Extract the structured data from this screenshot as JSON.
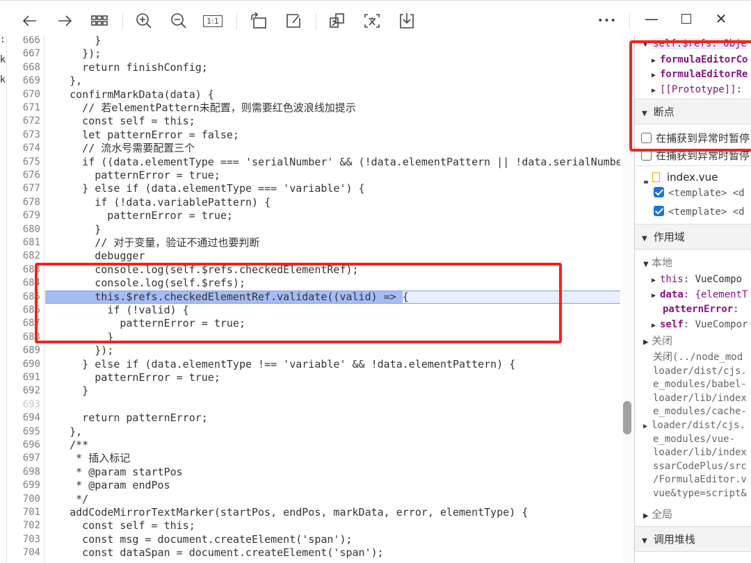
{
  "toolbar": {
    "icons": [
      "back-arrow-icon",
      "forward-arrow-icon",
      "grid-icon",
      "zoom-in-icon",
      "zoom-out-icon",
      "actual-size-icon",
      "rotate-icon",
      "edit-icon",
      "translate-icon",
      "ocr-text-icon",
      "download-icon"
    ],
    "actual_size_label": "1:1",
    "more_label": "•••",
    "minimize_label": "—",
    "close_label": "✕"
  },
  "left_strip": [
    "ɔ:",
    "ck",
    "ck"
  ],
  "colors": {
    "highlight_bg": "#a5bdf5",
    "paused_line_bg": "#e8efff",
    "annotation_red": "#f5221b",
    "property_purple": "#881280",
    "checkbox_blue": "#1a73e8"
  },
  "code": {
    "paused_line": 685,
    "lines": [
      {
        "num": "666",
        "text": "        }"
      },
      {
        "num": "667",
        "text": "      });"
      },
      {
        "num": "668",
        "text": "      return finishConfig;"
      },
      {
        "num": "669",
        "text": "    },"
      },
      {
        "num": "670",
        "text": "    confirmMarkData(data) {"
      },
      {
        "num": "671",
        "text": "      // 若elementPattern未配置，则需要红色波浪线加提示"
      },
      {
        "num": "672",
        "text": "      const self = this;"
      },
      {
        "num": "673",
        "text": "      let patternError = false;"
      },
      {
        "num": "674",
        "text": "      // 流水号需要配置三个"
      },
      {
        "num": "675",
        "text": "      if ((data.elementType === 'serialNumber' && (!data.elementPattern || !data.serialNumber"
      },
      {
        "num": "676",
        "text": "        patternError = true;"
      },
      {
        "num": "677",
        "text": "      } else if (data.elementType === 'variable') {"
      },
      {
        "num": "678",
        "text": "        if (!data.variablePattern) {"
      },
      {
        "num": "679",
        "text": "          patternError = true;"
      },
      {
        "num": "680",
        "text": "        }"
      },
      {
        "num": "681",
        "text": "        // 对于变量，验证不通过也要判断"
      },
      {
        "num": "682",
        "text": "        debugger"
      },
      {
        "num": "683",
        "text": "        console.log(self.$refs.checkedElementRef);"
      },
      {
        "num": "684",
        "text": "        console.log(self.$refs);"
      },
      {
        "num": "685",
        "text": "        this.$refs.checkedElementRef.validate((valid) => {"
      },
      {
        "num": "686",
        "text": "          if (!valid) {"
      },
      {
        "num": "687",
        "text": "            patternError = true;"
      },
      {
        "num": "688",
        "text": "          }"
      },
      {
        "num": "689",
        "text": "        });"
      },
      {
        "num": "690",
        "text": "      } else if (data.elementType !== 'variable' && !data.elementPattern) {"
      },
      {
        "num": "691",
        "text": "        patternError = true;"
      },
      {
        "num": "692",
        "text": "      }"
      },
      {
        "num": "693",
        "text": ""
      },
      {
        "num": "694",
        "text": "      return patternError;"
      },
      {
        "num": "695",
        "text": "    },"
      },
      {
        "num": "696",
        "text": "    /**"
      },
      {
        "num": "697",
        "text": "     * 插入标记"
      },
      {
        "num": "698",
        "text": "     * @param startPos"
      },
      {
        "num": "699",
        "text": "     * @param endPos"
      },
      {
        "num": "700",
        "text": "     */"
      },
      {
        "num": "701",
        "text": "    addCodeMirrorTextMarker(startPos, endPos, markData, error, elementType) {"
      },
      {
        "num": "702",
        "text": "      const self = this;"
      },
      {
        "num": "703",
        "text": "      const msg = document.createElement('span');"
      },
      {
        "num": "704",
        "text": "      const dataSpan = document.createElement('span');"
      }
    ]
  },
  "panel": {
    "watch": {
      "expr": "self.$refs: Obje",
      "children": [
        "formulaEditorCo",
        "formulaEditorRe",
        "[[Prototype]]: "
      ]
    },
    "breakpoints": {
      "title": "断点",
      "pause_on_caught": "在捕获到异常时暂停",
      "pause_on_caught_dup": "在捕获到异常时暂停",
      "file": "index.vue",
      "items": [
        "<template> <d",
        "<template> <d"
      ]
    },
    "scope": {
      "title": "作用域",
      "local": "本地",
      "this_key": "this",
      "this_val": ": VueCompo",
      "data_key": "data",
      "data_val": ": {elementT",
      "pe_key": "patternError",
      "pe_val": ": ",
      "self_key": "self",
      "self_val": ": VueCompor",
      "closure": "关闭",
      "closure_lines": [
        "关闭(../node_mod",
        "loader/dist/cjs.",
        "e_modules/babel-",
        "loader/lib/index",
        "e_modules/cache-",
        "loader/dist/cjs.",
        "e_modules/vue-",
        "loader/lib/index",
        "ssarCodePlus/src",
        "/FormulaEditor.v",
        "vue&type=script&"
      ],
      "global": "全局"
    },
    "callstack": {
      "title": "调用堆栈"
    }
  }
}
